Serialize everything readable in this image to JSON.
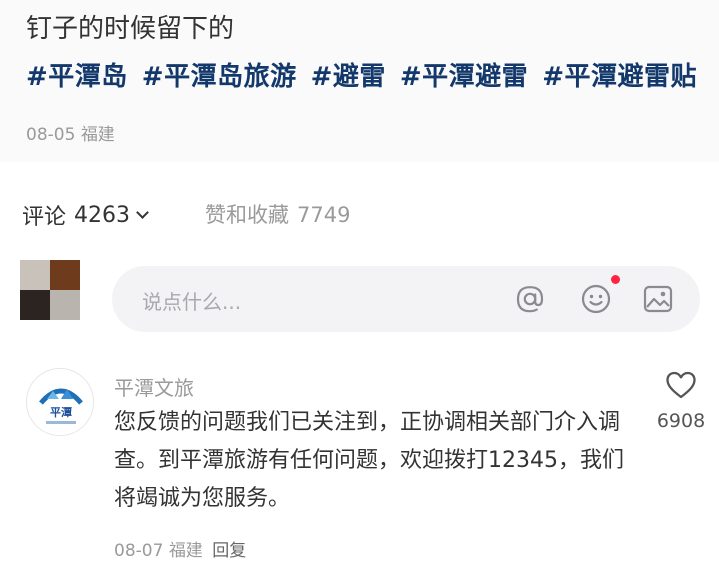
{
  "post": {
    "text": "钉子的时候留下的",
    "tags": [
      "#平潭岛",
      "#平潭岛旅游",
      "#避雷",
      "#平潭避雷",
      "#平潭避雷贴"
    ],
    "date": "08-05",
    "location": "福建"
  },
  "tabs": {
    "comments_label": "评论",
    "comments_count": "4263",
    "likes_label": "赞和收藏",
    "likes_count": "7749"
  },
  "input": {
    "placeholder": "说点什么..."
  },
  "comment": {
    "author": "平潭文旅",
    "body": "您反馈的问题我们已关注到，正协调相关部门介入调查。到平潭旅游有任何问题，欢迎拨打12345，我们将竭诚为您服务。",
    "date": "08-07",
    "location": "福建",
    "reply_label": "回复",
    "like_count": "6908",
    "avatar_text": "平潭"
  },
  "colors": {
    "tag": "#13386c",
    "notification_dot": "#ff2442",
    "input_bg": "#f3f3f6"
  },
  "icons": [
    "chevron-down-icon",
    "at-icon",
    "emoji-icon",
    "image-icon",
    "heart-icon"
  ]
}
